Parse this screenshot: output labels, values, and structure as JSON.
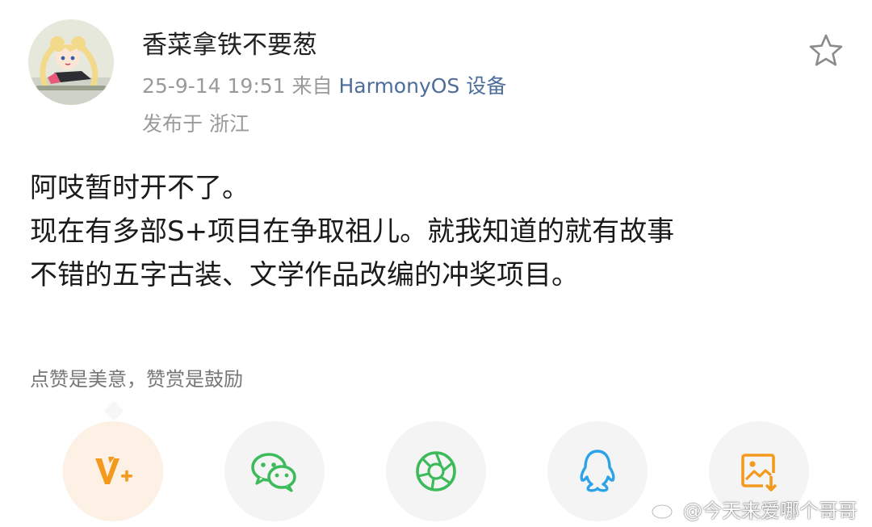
{
  "post": {
    "author": {
      "name": "香菜拿铁不要葱",
      "avatar_icon": "anime-avatar-icon"
    },
    "timestamp": "25-9-14 19:51",
    "source_prefix": "来自",
    "source_link": "HarmonyOS 设备",
    "location": "发布于 浙江",
    "body_lines": [
      "阿吱暂时开不了。",
      "现在有多部S+项目在争取祖儿。就我知道的就有故事",
      "不错的五字古装、文学作品改编的冲奖项目。"
    ],
    "favorite_icon": "star-outline-icon"
  },
  "reward": {
    "tip": "点赞是美意，赞赏是鼓励"
  },
  "share_bar": {
    "buttons": [
      {
        "name": "reward",
        "icon": "v-plus-icon",
        "color": "#f39a1e"
      },
      {
        "name": "wechat",
        "icon": "wechat-icon",
        "color": "#3dbb5a"
      },
      {
        "name": "moments",
        "icon": "moments-aperture-icon",
        "color": "#3dbb5a"
      },
      {
        "name": "qq",
        "icon": "qq-penguin-icon",
        "color": "#2ba3e6"
      },
      {
        "name": "save-image",
        "icon": "image-download-icon",
        "color": "#f39a1e"
      }
    ]
  },
  "watermark": {
    "text": "@今天来爱哪个哥哥",
    "icon": "weibo-logo-icon"
  },
  "colors": {
    "link": "#4d6d9a",
    "meta": "#9a9a9a",
    "accent_orange": "#f39a1e",
    "accent_green": "#3dbb5a",
    "accent_blue": "#2ba3e6"
  }
}
